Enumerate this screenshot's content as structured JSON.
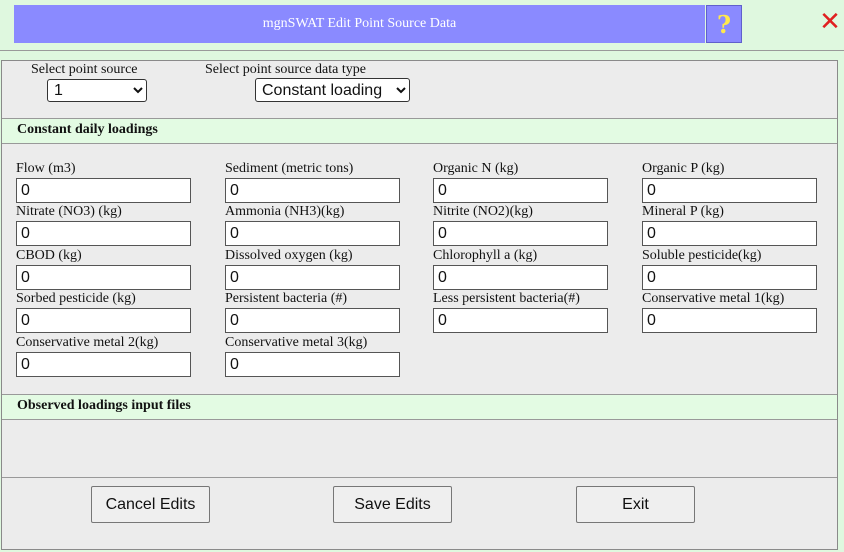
{
  "window": {
    "title": "mgnSWAT Edit Point Source Data",
    "help_label": "?",
    "close_label": "✕"
  },
  "selectors": {
    "point_source_label": "Select point source",
    "point_source_value": "1",
    "data_type_label": "Select point source data type",
    "data_type_value": "Constant loading"
  },
  "sections": {
    "constant": "Constant daily loadings",
    "observed": "Observed loadings input files"
  },
  "fields": [
    {
      "label": "Flow (m3)",
      "value": "0"
    },
    {
      "label": "Sediment (metric tons)",
      "value": "0"
    },
    {
      "label": "Organic N (kg)",
      "value": "0"
    },
    {
      "label": "Organic P (kg)",
      "value": "0"
    },
    {
      "label": "Nitrate (NO3) (kg)",
      "value": "0"
    },
    {
      "label": "Ammonia (NH3)(kg)",
      "value": "0"
    },
    {
      "label": "Nitrite (NO2)(kg)",
      "value": "0"
    },
    {
      "label": "Mineral P (kg)",
      "value": "0"
    },
    {
      "label": "CBOD (kg)",
      "value": "0"
    },
    {
      "label": "Dissolved oxygen (kg)",
      "value": "0"
    },
    {
      "label": "Chlorophyll a (kg)",
      "value": "0"
    },
    {
      "label": "Soluble pesticide(kg)",
      "value": "0"
    },
    {
      "label": "Sorbed pesticide (kg)",
      "value": "0"
    },
    {
      "label": "Persistent bacteria (#)",
      "value": "0"
    },
    {
      "label": "Less persistent bacteria(#)",
      "value": "0"
    },
    {
      "label": "Conservative metal 1(kg)",
      "value": "0"
    },
    {
      "label": "Conservative metal 2(kg)",
      "value": "0"
    },
    {
      "label": "Conservative metal 3(kg)",
      "value": "0"
    }
  ],
  "buttons": {
    "cancel": "Cancel Edits",
    "save": "Save Edits",
    "exit": "Exit"
  },
  "colors": {
    "title_bar": "#8a8aff",
    "page_background": "#dff8df",
    "help_icon": "#ffe84d",
    "close_icon": "#e02020"
  }
}
